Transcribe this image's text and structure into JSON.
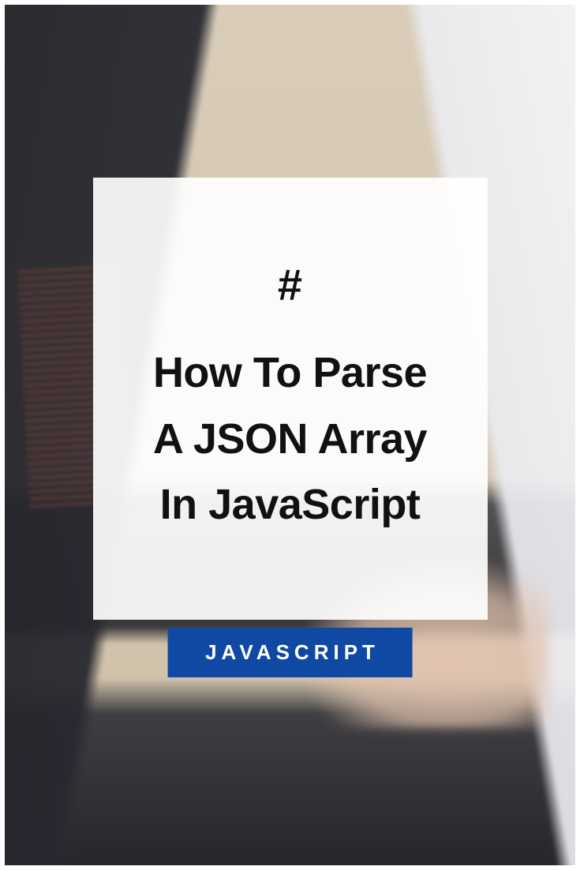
{
  "card": {
    "hash": "#",
    "title_line1": "How To Parse",
    "title_line2": "A JSON Array",
    "title_line3": "In JavaScript"
  },
  "tag": {
    "label": "JAVASCRIPT"
  },
  "colors": {
    "tag_bg": "#1049a3",
    "card_bg": "rgba(255,255,255,0.92)"
  }
}
